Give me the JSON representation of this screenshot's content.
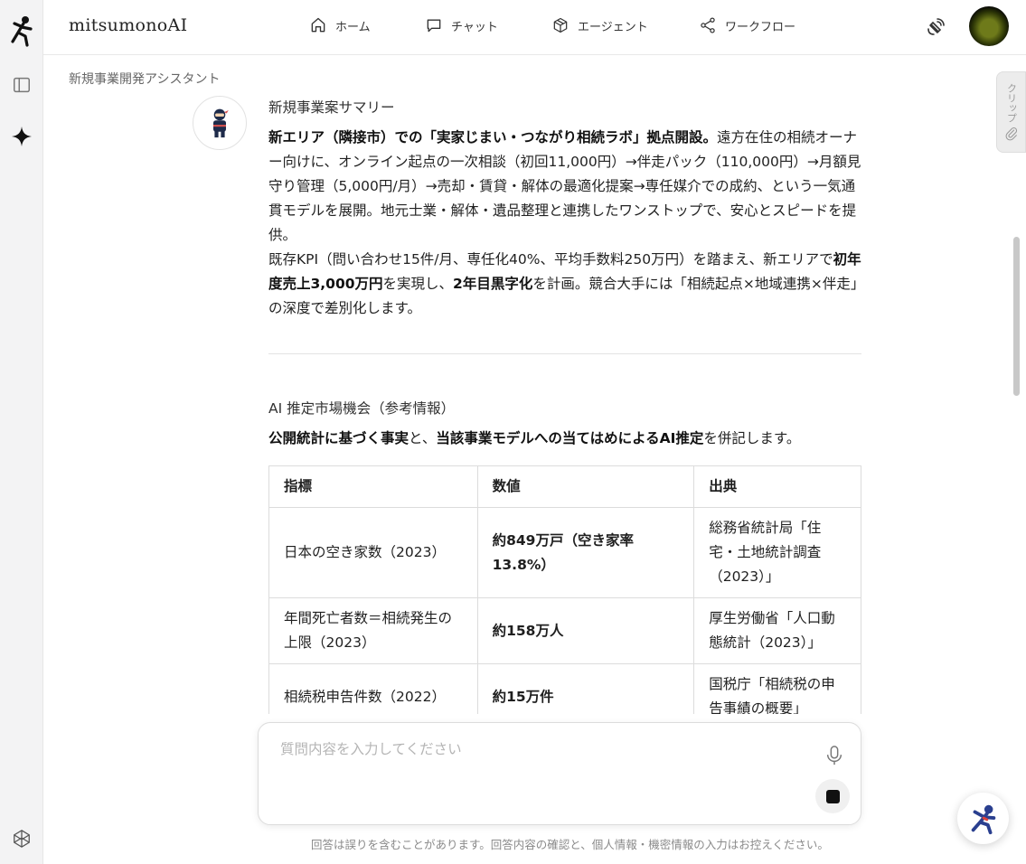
{
  "app": {
    "brand": "mitsumonoAI"
  },
  "nav": [
    {
      "label": "ホーム",
      "icon": "home-icon"
    },
    {
      "label": "チャット",
      "icon": "chat-icon"
    },
    {
      "label": "エージェント",
      "icon": "cube-icon"
    },
    {
      "label": "ワークフロー",
      "icon": "share-icon"
    }
  ],
  "breadcrumb": "新規事業開発アシスタント",
  "summary": {
    "title": "新規事業案サマリー",
    "p1_bold": "新エリア（隣接市）での「実家じまい・つながり相続ラボ」拠点開設。",
    "p1_rest": "遠方在住の相続オーナー向けに、オンライン起点の一次相談（初回11,000円）→伴走パック（110,000円）→月額見守り管理（5,000円/月）→売却・賃貸・解体の最適化提案→専任媒介での成約、という一気通貫モデルを展開。地元士業・解体・遺品整理と連携したワンストップで、安心とスピードを提供。",
    "p2_a": "既存KPI（問い合わせ15件/月、専任化40%、平均手数料250万円）を踏まえ、新エリアで",
    "p2_b1": "初年度売上3,000万円",
    "p2_c": "を実現し、",
    "p2_b2": "2年目黒字化",
    "p2_d": "を計画。競合大手には「相続起点×地域連携×伴走」の深度で差別化します。"
  },
  "market": {
    "title": "AI 推定市場機会（参考情報）",
    "intro_b1": "公開統計に基づく事実",
    "intro_and": "と、",
    "intro_b2": "当該事業モデルへの当てはめによるAI推定",
    "intro_end": "を併記します。",
    "headers": [
      "指標",
      "数値",
      "出典"
    ],
    "rows": [
      {
        "metric": "日本の空き家数（2023）",
        "value": "約849万戸（空き家率13.8%）",
        "source": "総務省統計局「住宅・土地統計調査（2023）」"
      },
      {
        "metric": "年間死亡者数＝相続発生の上限（2023）",
        "value": "約158万人",
        "source": "厚生労働省「人口動態統計（2023）」"
      },
      {
        "metric": "相続税申告件数（2022）",
        "value": "約15万件",
        "source": "国税庁「相続税の申告事績の概要」"
      }
    ]
  },
  "input": {
    "placeholder": "質問内容を入力してください"
  },
  "disclaimer": "回答は誤りを含むことがあります。回答内容の確認と、個人情報・機密情報の入力はお控えください。",
  "clip": {
    "label": "クリップ"
  },
  "icons": {
    "logo": "ninja-logo-icon",
    "sidebar": "sidebar-toggle-icon",
    "sparkle": "sparkle-icon",
    "codepen": "cube-outline-icon",
    "satellite": "satellite-icon",
    "mic": "mic-icon",
    "stop": "stop-icon",
    "paperclip": "paperclip-icon"
  },
  "colors": {
    "rail_bg": "#f3f3f4",
    "text": "#1f1f1f",
    "border": "#dcdcdc"
  }
}
